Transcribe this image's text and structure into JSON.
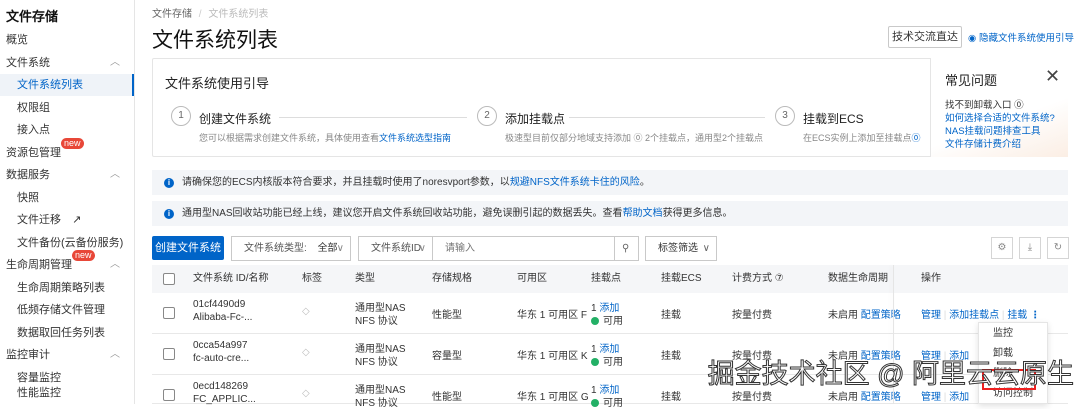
{
  "sidebar": {
    "title": "文件存储",
    "items": [
      {
        "label": "概览"
      },
      {
        "label": "文件系统"
      },
      {
        "label": "文件系统列表"
      },
      {
        "label": "权限组"
      },
      {
        "label": "接入点"
      },
      {
        "label": "资源包管理",
        "badge": "new"
      },
      {
        "label": "数据服务"
      },
      {
        "label": "快照"
      },
      {
        "label": "文件迁移"
      },
      {
        "label": "文件备份(云备份服务)"
      },
      {
        "label": "生命周期管理",
        "badge": "new"
      },
      {
        "label": "生命周期策略列表"
      },
      {
        "label": "低频存储文件管理"
      },
      {
        "label": "数据取回任务列表"
      },
      {
        "label": "监控审计"
      },
      {
        "label": "容量监控"
      },
      {
        "label": "性能监控"
      }
    ]
  },
  "breadcrumb": [
    "文件存储",
    "文件系统列表"
  ],
  "page_title": "文件系统列表",
  "header": {
    "tech_button": "技术交流直达",
    "hide_guide": "隐藏文件系统使用引导"
  },
  "guide": {
    "title": "文件系统使用引导",
    "steps": [
      {
        "num": "1",
        "title": "创建文件系统",
        "desc": "您可以根据需求创建文件系统，具体使用查看",
        "link": "文件系统选型指南"
      },
      {
        "num": "2",
        "title": "添加挂载点",
        "desc": "极速型目前仅部分地域支持添加 ⓪ 2个挂载点，通用型2个挂载点",
        "link": ""
      },
      {
        "num": "3",
        "title": "挂载到ECS",
        "desc": "在ECS实例上添加至挂载点",
        "link": "⓪"
      }
    ]
  },
  "faq": {
    "title": "常见问题",
    "items": [
      "找不到卸载入口 ⓪",
      "如何选择合适的文件系统?",
      "NAS挂载问题排查工具",
      "文件存储计费介绍"
    ]
  },
  "banners": [
    {
      "text": "请确保您的ECS内核版本符合要求，并且挂载时使用了noresvport参数，以",
      "link": "规避NFS文件系统卡住的风险",
      "after": "。"
    },
    {
      "text": "通用型NAS回收站功能已经上线，建议您开启文件系统回收站功能，避免误删引起的数据丢失。查看",
      "link": "帮助文档",
      "after": "获得更多信息。"
    }
  ],
  "toolbar": {
    "create": "创建文件系统",
    "type_label": "文件系统类型:",
    "type_value": "全部",
    "search_field": "文件系统ID",
    "search_placeholder": "请输入",
    "tag_filter": "标签筛选"
  },
  "table": {
    "headers": [
      "文件系统 ID/名称",
      "标签",
      "类型",
      "存储规格",
      "可用区",
      "挂载点",
      "挂载ECS",
      "计费方式 ⑦",
      "数据生命周期",
      "操作"
    ],
    "rows": [
      {
        "id": "01cf4490d9",
        "name": "Alibaba-Fc-...",
        "type1": "通用型NAS",
        "type2": "NFS 协议",
        "spec": "性能型",
        "zone": "华东 1 可用区 F",
        "mount_count": "1",
        "mount_add": "添加",
        "status": "可用",
        "ecs": "挂载",
        "billing": "按量付费",
        "lifecycle": "未启用",
        "lifecycle_link": "配置策略",
        "ops": [
          "管理",
          "添加挂载点",
          "挂载"
        ]
      },
      {
        "id": "0cca54a997",
        "name": "fc-auto-cre...",
        "type1": "通用型NAS",
        "type2": "NFS 协议",
        "spec": "容量型",
        "zone": "华东 1 可用区 K",
        "mount_count": "1",
        "mount_add": "添加",
        "status": "可用",
        "ecs": "挂载",
        "billing": "按量付费",
        "lifecycle": "未启用",
        "lifecycle_link": "配置策略",
        "ops": [
          "管理",
          "添加"
        ]
      },
      {
        "id": "0ecd148269",
        "name": "FC_APPLIC...",
        "type1": "通用型NAS",
        "type2": "NFS 协议",
        "spec": "性能型",
        "zone": "华东 1 可用区 G",
        "mount_count": "1",
        "mount_add": "添加",
        "status": "可用",
        "ecs": "挂载",
        "billing": "按量付费",
        "lifecycle": "未启用",
        "lifecycle_link": "配置策略",
        "ops": [
          "管理",
          "添加"
        ]
      }
    ]
  },
  "more_menu": [
    "监控",
    "卸载",
    "删除",
    "访问控制"
  ],
  "watermark": "掘金技术社区 @ 阿里云云原生"
}
